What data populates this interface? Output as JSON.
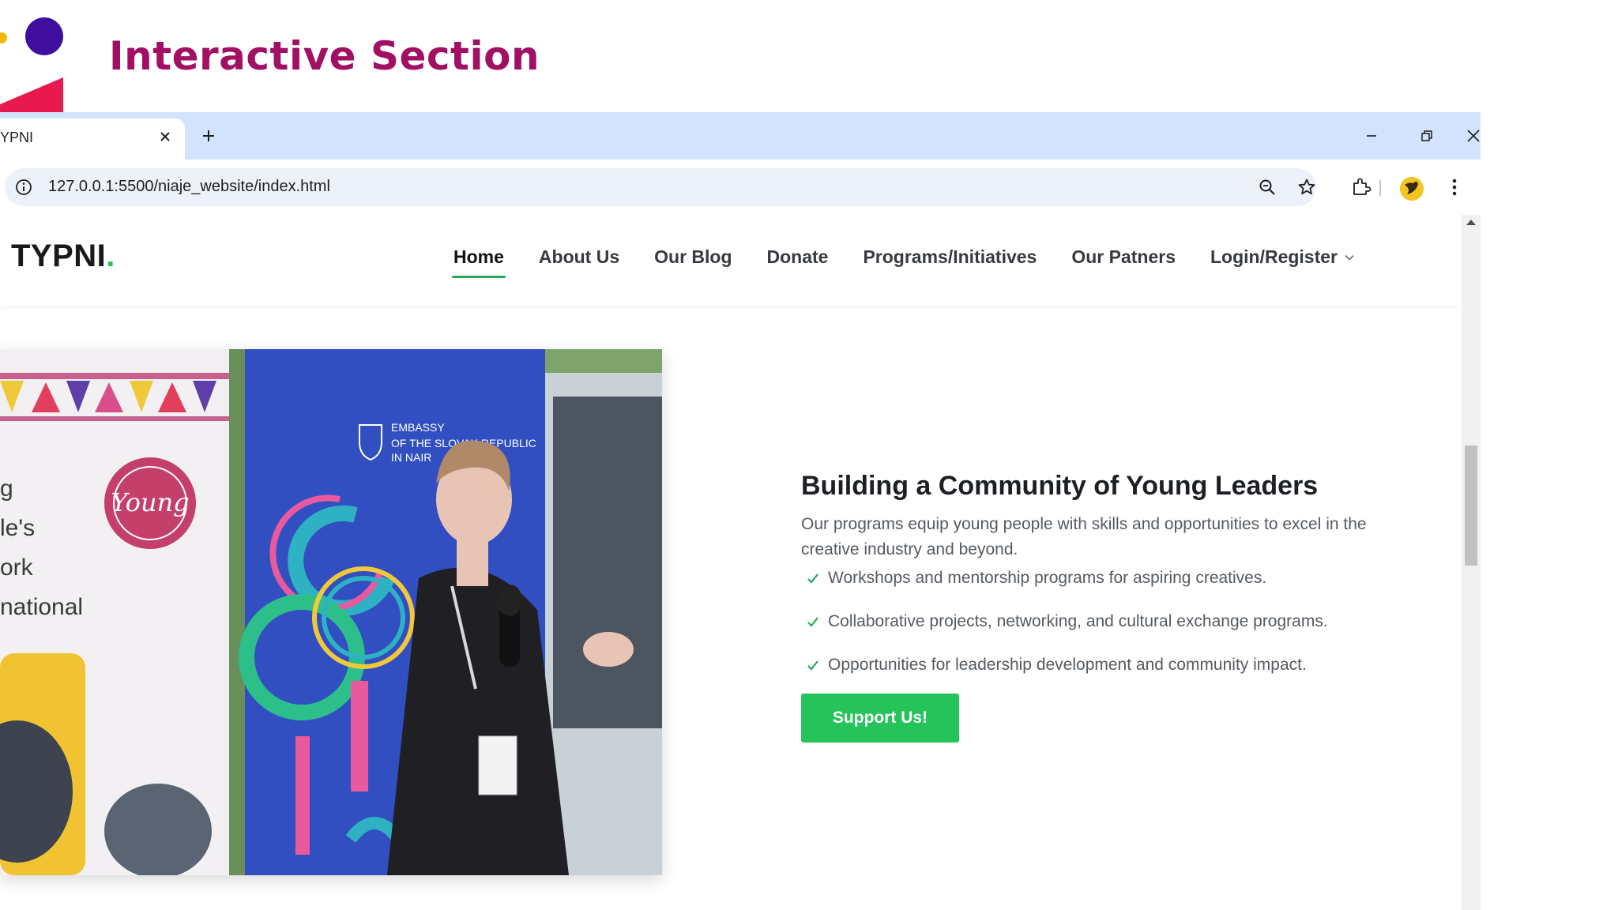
{
  "slide": {
    "title": "Interactive Section"
  },
  "browser": {
    "tab_title": "YPNI",
    "url": "127.0.0.1:5500/niaje_website/index.html"
  },
  "site": {
    "logo_text": "TYPNI",
    "logo_dot": ".",
    "nav": [
      {
        "label": "Home",
        "active": true
      },
      {
        "label": "About Us",
        "active": false
      },
      {
        "label": "Our Blog",
        "active": false
      },
      {
        "label": "Donate",
        "active": false
      },
      {
        "label": "Programs/Initiatives",
        "active": false
      },
      {
        "label": "Our Patners",
        "active": false
      },
      {
        "label": "Login/Register",
        "active": false,
        "dropdown": true
      }
    ],
    "hero_image": {
      "poster_words": [
        "g",
        "le's",
        "ork",
        "national"
      ],
      "badge_text": "Young",
      "banner_lines": [
        "EMBASSY",
        "OF THE SLOVAK REPUBLIC",
        "IN NAIR"
      ]
    },
    "content": {
      "title": "Building a Community of Young Leaders",
      "description": "Our programs equip young people with skills and opportunities to excel in the creative industry and beyond.",
      "items": [
        "Workshops and mentorship programs for aspiring creatives.",
        "Collaborative projects, networking, and cultural exchange programs.",
        "Opportunities for leadership development and community impact."
      ],
      "button_label": "Support Us!"
    }
  },
  "colors": {
    "slide_title": "#a11063",
    "tabstrip": "#d3e3fd",
    "accent_green": "#26c35b",
    "nav_underline": "#26a85b"
  }
}
